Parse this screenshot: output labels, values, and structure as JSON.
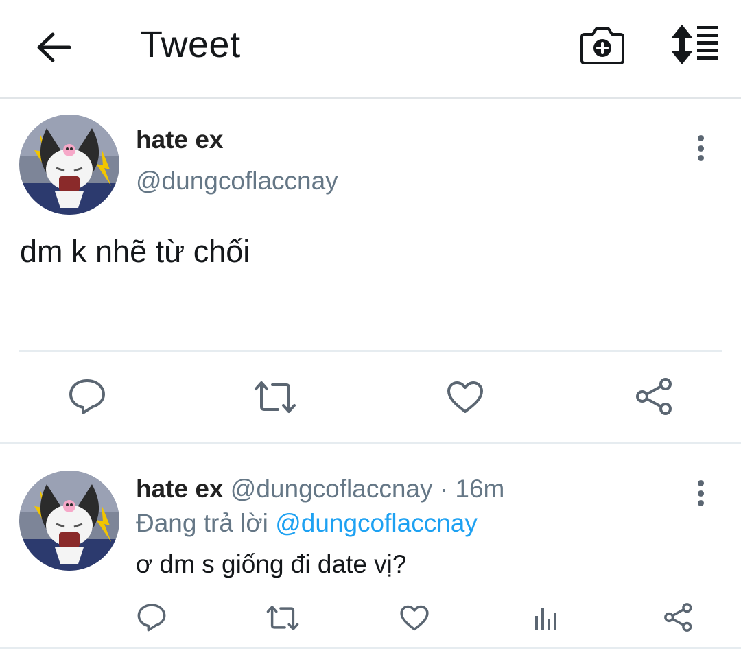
{
  "header": {
    "title": "Tweet",
    "back_icon": "arrow-left-icon",
    "camera_icon": "camera-plus-icon",
    "sort_icon": "sort-list-icon"
  },
  "main_tweet": {
    "display_name": "hate ex",
    "handle": "@dungcoflaccnay",
    "text": "dm k nhẽ từ chối",
    "actions": [
      "reply-icon",
      "retweet-icon",
      "like-icon",
      "share-icon"
    ]
  },
  "reply": {
    "display_name": "hate ex",
    "handle": "@dungcoflaccnay",
    "separator": "·",
    "time": "16m",
    "replying_to_label": "Đang trả lời",
    "replying_to_handle": "@dungcoflaccnay",
    "text": "ơ dm s giống đi date vị?",
    "actions": [
      "reply-icon",
      "retweet-icon",
      "like-icon",
      "analytics-icon",
      "share-icon"
    ]
  },
  "colors": {
    "text_primary": "#14171a",
    "text_secondary": "#657786",
    "accent": "#1da1f2",
    "icon": "#5b6672",
    "divider": "#e6ecf0"
  }
}
